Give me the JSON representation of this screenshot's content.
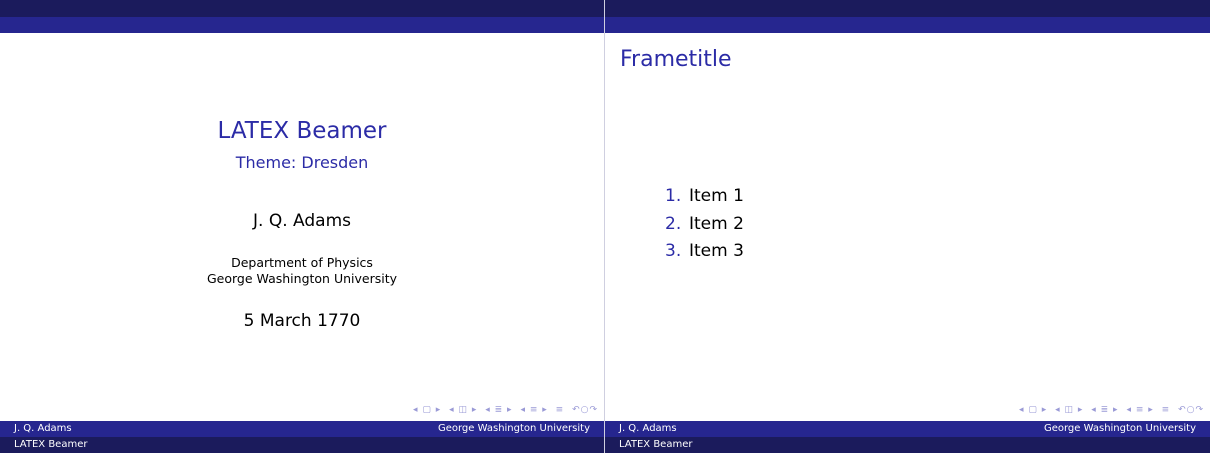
{
  "title_slide": {
    "title": "LATEX Beamer",
    "subtitle": "Theme: Dresden",
    "author": "J. Q. Adams",
    "department": "Department of Physics",
    "institution": "George Washington University",
    "date": "5 March 1770"
  },
  "content_slide": {
    "frametitle": "Frametitle",
    "items": [
      {
        "number": "1.",
        "label": "Item 1"
      },
      {
        "number": "2.",
        "label": "Item 2"
      },
      {
        "number": "3.",
        "label": "Item 3"
      }
    ]
  },
  "footer": {
    "author": "J. Q. Adams",
    "institution": "George Washington University",
    "short_title": "LATEX Beamer"
  },
  "navigation_icons": [
    "frame-nav-icon",
    "subsection-nav-icon",
    "section-nav-icon",
    "document-nav-icon",
    "appendix-icon",
    "search-icon"
  ],
  "colors": {
    "header_dark": "#1b1b5c",
    "header_light": "#26268f",
    "title_blue": "#2b2ba6"
  }
}
